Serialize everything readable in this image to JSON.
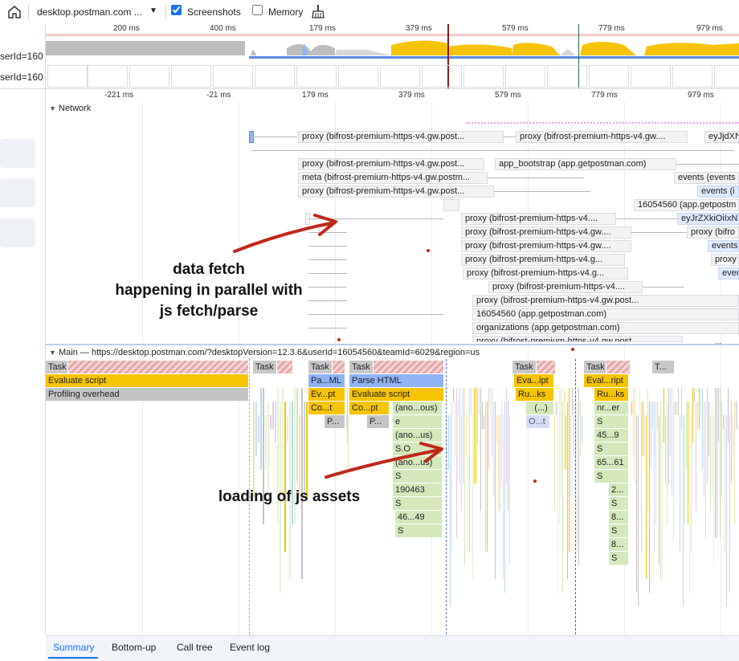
{
  "toolbar": {
    "recording_title": "desktop.postman.com ...",
    "screenshots_label": "Screenshots",
    "screenshots_checked": true,
    "memory_label": "Memory",
    "memory_checked": false
  },
  "overview_ruler": [
    "200 ms",
    "400 ms",
    "179 ms",
    "379 ms",
    "579 ms",
    "779 ms",
    "979 ms"
  ],
  "left_labels": [
    "serId=160",
    "serId=160"
  ],
  "main_ruler": [
    "-221 ms",
    "-21 ms",
    "179 ms",
    "379 ms",
    "579 ms",
    "779 ms",
    "979 ms"
  ],
  "network": {
    "title": "Network",
    "requests": [
      "proxy (bifrost-premium-https-v4.gw.post...",
      "proxy (bifrost-premium-https-v4.gw....",
      "eyJjdXN",
      "proxy (bifrost-premium-https-v4.gw.post...",
      "app_bootstrap (app.getpostman.com)",
      "meta (bifrost-premium-https-v4.gw.postm...",
      "events (events",
      "proxy (bifrost-premium-https-v4.gw.post...",
      "events (i",
      "16054560 (app.getpostm",
      "proxy (bifrost-premium-https-v4....",
      "eyJrZXkiOiIxN",
      "proxy (bifrost-premium-https-v4.gw....",
      "proxy (bifro",
      "proxy (bifrost-premium-https-v4.gw....",
      "events",
      "proxy (bifrost-premium-https-v4.g...",
      "proxy",
      "proxy (bifrost-premium-https-v4.g...",
      "ever",
      "proxy (bifrost-premium-https-v4....",
      "proxy (bifrost-premium-https-v4.gw.post...",
      "16054560 (app.getpostman.com)",
      "organizations (app.getpostman.com)",
      "proxy (bifrost-premium-https-v4.gw.post"
    ]
  },
  "main_track": {
    "title": "Main — https://desktop.postman.com/?desktopVersion=12.3.6&userId=16054560&teamId=6029&region=us",
    "row1": [
      "Task",
      "Task",
      "Task",
      "Task",
      "Task",
      "Task",
      "T..."
    ],
    "left_blocks": [
      "Evaluate script",
      "Profiling overhead"
    ],
    "col_a": [
      "Pa...ML",
      "Ev...pt",
      "Co...t",
      "P..."
    ],
    "col_b": [
      "Parse HTML",
      "Evaluate script",
      "Co...pt",
      "P..."
    ],
    "col_c": [
      "(ano...ous)",
      "e",
      "(ano...us)",
      "S.O",
      "(ano...us)",
      "S",
      "190463",
      "S",
      "46...49",
      "S"
    ],
    "col_d": [
      "Eva...ipt",
      "Ru...ks",
      "(...)",
      "O...t"
    ],
    "col_e": [
      "Eval...ript",
      "Ru...ks",
      "nr...er",
      "S",
      "45...9",
      "S",
      "65...61",
      "S",
      "2...",
      "S",
      "8...",
      "S",
      "8...",
      "S"
    ]
  },
  "annotations": {
    "fetch": "data fetch\nhappening in parallel with\njs fetch/parse",
    "assets": "loading of js assets"
  },
  "bottom_tabs": [
    "Summary",
    "Bottom-up",
    "Call tree",
    "Event log"
  ],
  "colors": {
    "scripting": "#f6c400",
    "loading": "#8fb3f5",
    "task": "#c8c8c8",
    "annotation_arrow": "#c0281b",
    "active_tab": "#1a73e8"
  }
}
